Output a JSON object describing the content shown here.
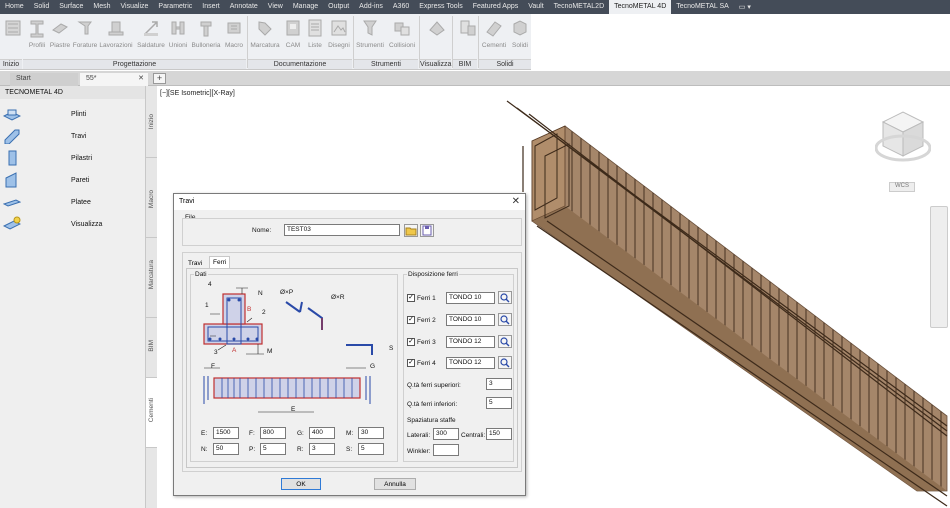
{
  "menu": [
    "Home",
    "Solid",
    "Surface",
    "Mesh",
    "Visualize",
    "Parametric",
    "Insert",
    "Annotate",
    "View",
    "Manage",
    "Output",
    "Add-ins",
    "A360",
    "Express Tools",
    "Featured Apps",
    "Vault",
    "TecnoMETAL2D",
    "TecnoMETAL 4D",
    "TecnoMETAL SA"
  ],
  "ribbon": {
    "buttons": [
      "Profili",
      "Piastre",
      "Forature",
      "Lavorazioni",
      "Saldature",
      "Unioni",
      "Bulloneria",
      "Macro",
      "Marcatura",
      "CAM",
      "Liste",
      "Disegni",
      "Strumenti",
      "Collisioni",
      "Cementi",
      "Solidi"
    ],
    "groups": [
      "Inizio",
      "Progettazione",
      "Documentazione",
      "Strumenti",
      "Visualizza",
      "BIM",
      "Solidi"
    ]
  },
  "tabs": {
    "start": "Start",
    "current": "55*"
  },
  "panel": {
    "title": "TECNOMETAL 4D",
    "items": [
      "Plinti",
      "Travi",
      "Pilastri",
      "Pareti",
      "Platee",
      "Visualizza"
    ],
    "vtabs": [
      "Inizio",
      "Macro",
      "Marcatura",
      "BIM",
      "Cementi"
    ]
  },
  "viewport": {
    "label": "[−][SE Isometric][X-Ray]",
    "wcs": "WCS"
  },
  "dialog": {
    "title": "Travi",
    "file_label": "File",
    "nome_label": "Nome:",
    "nome_value": "TEST03",
    "tabs": [
      "Travi",
      "Ferri"
    ],
    "dati_label": "Dati",
    "disposizione_label": "Disposizione ferri",
    "ferri": [
      {
        "label": "Ferri 1",
        "value": "TONDO 10",
        "checked": true
      },
      {
        "label": "Ferri 2",
        "value": "TONDO 10",
        "checked": true
      },
      {
        "label": "Ferri 3",
        "value": "TONDO 12",
        "checked": true
      },
      {
        "label": "Ferri 4",
        "value": "TONDO 12",
        "checked": true
      }
    ],
    "qta_sup_label": "Q.tà ferri superiori:",
    "qta_sup_value": "3",
    "qta_inf_label": "Q.tà ferri inferiori:",
    "qta_inf_value": "5",
    "spaziatura_label": "Spaziatura staffe",
    "laterali_label": "Laterali:",
    "laterali_value": "300",
    "centrali_label": "Centrali:",
    "centrali_value": "150",
    "winkler_label": "Winkler:",
    "winkler_value": "",
    "params": [
      {
        "label": "E:",
        "value": "1500"
      },
      {
        "label": "F:",
        "value": "800"
      },
      {
        "label": "G:",
        "value": "400"
      },
      {
        "label": "M:",
        "value": "30"
      },
      {
        "label": "N:",
        "value": "50"
      },
      {
        "label": "P:",
        "value": "5"
      },
      {
        "label": "R:",
        "value": "3"
      },
      {
        "label": "S:",
        "value": "5"
      }
    ],
    "diagram": {
      "labels": [
        "4",
        "N",
        "1",
        "B",
        "2",
        "3",
        "A",
        "M",
        "Ø×P",
        "Ø×R",
        "S",
        "F",
        "G",
        "E"
      ]
    },
    "ok": "OK",
    "cancel": "Annulla"
  }
}
